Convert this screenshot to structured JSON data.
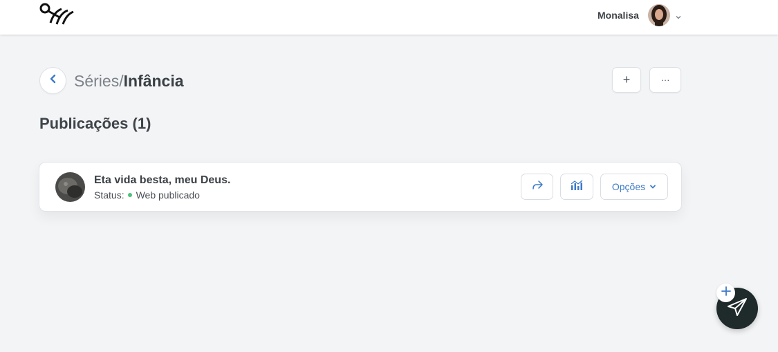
{
  "topbar": {
    "logo_name": "brand-logo",
    "user_name": "Monalisa"
  },
  "header": {
    "breadcrumb_parent": "Séries",
    "breadcrumb_separator": "/",
    "breadcrumb_current": "Infância",
    "add_label": "+",
    "more_label": "···"
  },
  "section": {
    "title": "Publicações (1)"
  },
  "publications": [
    {
      "title": "Eta vida besta, meu Deus.",
      "status_label": "Status:",
      "status_value": "Web publicado",
      "options_label": "Opções"
    }
  ],
  "colors": {
    "accent": "#3c7ac7",
    "status_published": "#4cc27a",
    "fab_background": "#1f2a2a",
    "page_background": "#f3f4f6"
  },
  "icons": [
    "back-arrow-icon",
    "share-icon",
    "stats-icon",
    "chevron-down-icon",
    "paper-plane-icon",
    "plus-icon"
  ]
}
